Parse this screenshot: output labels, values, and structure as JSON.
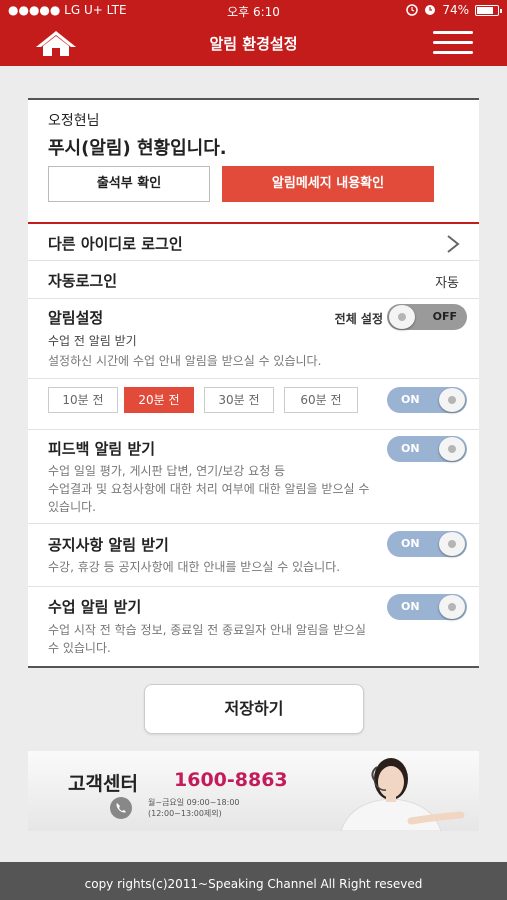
{
  "status_bar": {
    "carrier": "●●●●● LG U+  LTE",
    "time": "오후 6:10",
    "icons": [
      "alarm-icon",
      "clock-icon"
    ],
    "battery": "74%",
    "battery_level": 0.74
  },
  "header": {
    "title": "알림 환경설정",
    "home_icon": "home-icon",
    "menu_icon": "hamburger-menu-icon"
  },
  "greeting": {
    "name": "오정현님",
    "title": "푸시(알림) 현황입니다.",
    "attendance_button": "출석부 확인",
    "message_button": "알림메세지 내용확인"
  },
  "rows": {
    "switch_id": {
      "label": "다른 아이디로 로그인"
    },
    "auto_login": {
      "label": "자동로그인",
      "value": "자동"
    },
    "alarm_settings": {
      "label": "알림설정",
      "all_setting_label": "전체 설정",
      "all_toggle": "OFF",
      "sub_title": "수업 전 알림 받기",
      "desc": "설정하신 시간에 수업 안내 알림을 받으실 수 있습니다.",
      "time_options": [
        "10분 전",
        "20분 전",
        "30분 전",
        "60분 전"
      ],
      "selected_option": "20분 전",
      "toggle": "ON"
    },
    "feedback": {
      "label": "피드백 알림 받기",
      "desc_line1": "수업 일일 평가, 게시판 답변, 연기/보강 요청 등",
      "desc_line2": "수업결과 및 요청사항에 대한 처리 여부에 대한 알림을 받으실 수",
      "desc_line3": "있습니다.",
      "toggle": "ON"
    },
    "notice": {
      "label": "공지사항 알림 받기",
      "desc": "수강, 휴강 등 공지사항에 대한 안내를 받으실 수 있습니다.",
      "toggle": "ON"
    },
    "class_alarm": {
      "label": "수업 알림 받기",
      "desc_line1": "수업 시작 전 학습 정보, 종료일 전 종료일자 안내 알림을 받으실",
      "desc_line2": "수 있습니다.",
      "toggle": "ON"
    }
  },
  "save_button": "저장하기",
  "banner": {
    "title": "고객센터",
    "phone": "1600-8863",
    "hours_line1": "월~금요일 09:00~18:00",
    "hours_line2": "(12:00~13:00제외)",
    "colors": {
      "phone": "#c41b5b"
    }
  },
  "footer": "copy rights(c)2011~Speaking Channel All Right reseved",
  "colors": {
    "brand": "#c41b1b",
    "accent": "#e24b3a",
    "toggle_on": "#9ab3d2"
  }
}
